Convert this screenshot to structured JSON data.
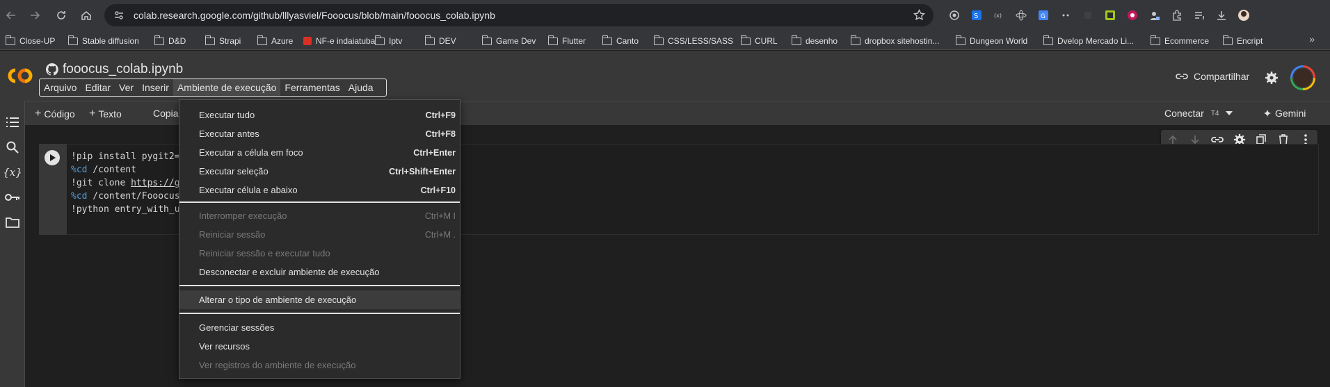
{
  "browser": {
    "url": "colab.research.google.com/github/lllyasviel/Fooocus/blob/main/fooocus_colab.ipynb",
    "bookmarks": [
      {
        "label": "Close-UP"
      },
      {
        "label": "Stable diffusion"
      },
      {
        "label": "D&D"
      },
      {
        "label": "Strapi"
      },
      {
        "label": "Azure"
      },
      {
        "label": "NF-e indaiatuba"
      },
      {
        "label": "Iptv"
      },
      {
        "label": "DEV"
      },
      {
        "label": "Game Dev"
      },
      {
        "label": "Flutter"
      },
      {
        "label": "Canto"
      },
      {
        "label": "CSS/LESS/SASS"
      },
      {
        "label": "CURL"
      },
      {
        "label": "desenho"
      },
      {
        "label": "dropbox sitehostin..."
      },
      {
        "label": "Dungeon World"
      },
      {
        "label": "Dvelop Mercado Li..."
      },
      {
        "label": "Ecommerce"
      },
      {
        "label": "Encript"
      }
    ]
  },
  "colab": {
    "logo_text": "CO",
    "notebook_title": "fooocus_colab.ipynb",
    "menu": [
      "Arquivo",
      "Editar",
      "Ver",
      "Inserir",
      "Ambiente de execução",
      "Ferramentas",
      "Ajuda"
    ],
    "share_label": "Compartilhar",
    "toolbar": {
      "code_label": "Código",
      "text_label": "Texto",
      "copy_label": "Copia",
      "connect_label": "Conectar",
      "runtime_badge": "T4",
      "gemini_label": "Gemini"
    }
  },
  "cell": {
    "lines": [
      {
        "prefix": "",
        "text": "!pip install pygit2="
      },
      {
        "prefix": "%cd",
        "text": " /content"
      },
      {
        "prefix": "",
        "text": "!git clone ",
        "link": "https://g"
      },
      {
        "prefix": "%cd",
        "text": " /content/Fooocus"
      },
      {
        "prefix": "",
        "text": "!python entry_with_u"
      }
    ]
  },
  "runtime_menu": {
    "items": [
      {
        "label": "Executar tudo",
        "shortcut": "Ctrl+F9",
        "disabled": false
      },
      {
        "label": "Executar antes",
        "shortcut": "Ctrl+F8",
        "disabled": false
      },
      {
        "label": "Executar a célula em foco",
        "shortcut": "Ctrl+Enter",
        "disabled": false
      },
      {
        "label": "Executar seleção",
        "shortcut": "Ctrl+Shift+Enter",
        "disabled": false
      },
      {
        "label": "Executar célula e abaixo",
        "shortcut": "Ctrl+F10",
        "disabled": false
      },
      {
        "label": "Interromper execução",
        "shortcut": "Ctrl+M I",
        "disabled": true
      },
      {
        "label": "Reiniciar sessão",
        "shortcut": "Ctrl+M .",
        "disabled": true
      },
      {
        "label": "Reiniciar sessão e executar tudo",
        "shortcut": "",
        "disabled": true
      },
      {
        "label": "Desconectar e excluir ambiente de execução",
        "shortcut": "",
        "disabled": false
      },
      {
        "label": "Alterar o tipo de ambiente de execução",
        "shortcut": "",
        "disabled": false
      },
      {
        "label": "Gerenciar sessões",
        "shortcut": "",
        "disabled": false
      },
      {
        "label": "Ver recursos",
        "shortcut": "",
        "disabled": false
      },
      {
        "label": "Ver registros do ambiente de execução",
        "shortcut": "",
        "disabled": true
      }
    ]
  },
  "colors": {
    "accent_orange": "#f9ab00",
    "code_keyword": "#569cd6"
  }
}
